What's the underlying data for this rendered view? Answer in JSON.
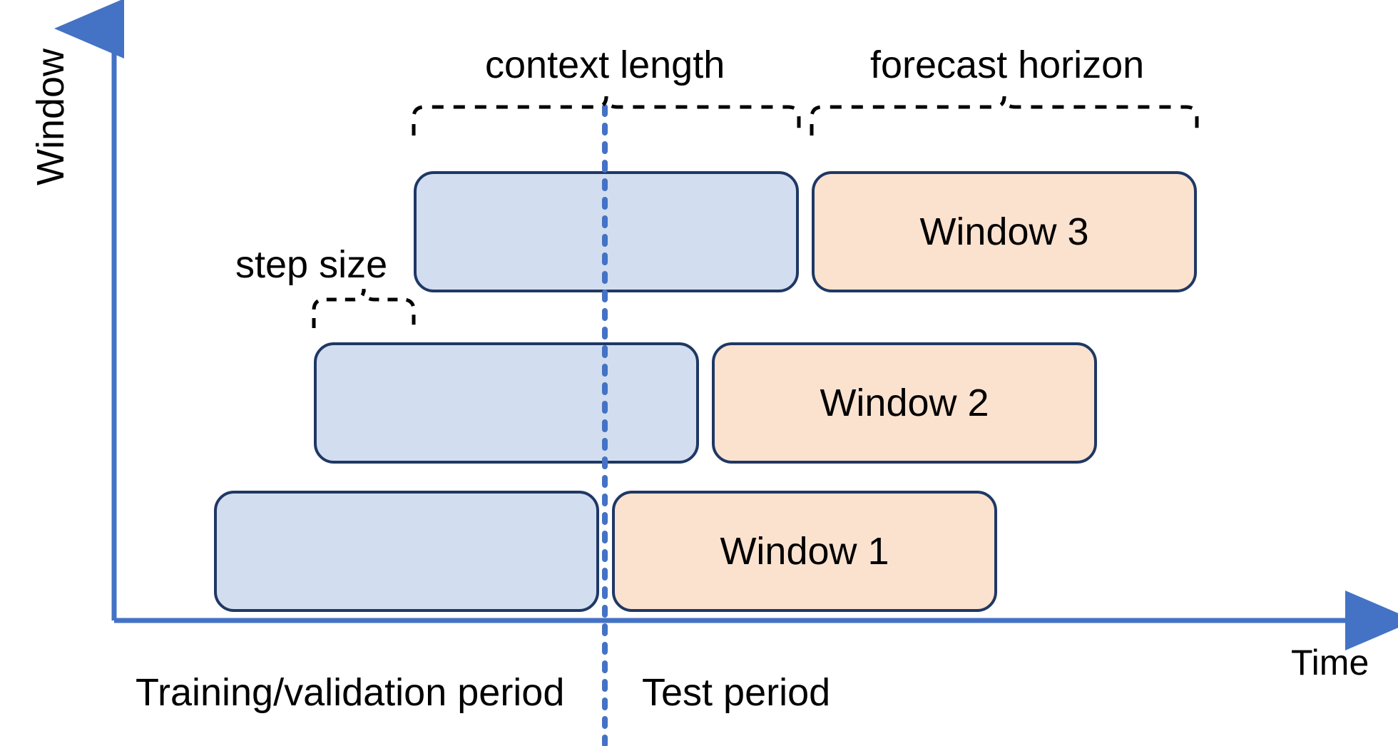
{
  "chart_data": {
    "type": "diagram",
    "title": "",
    "x_axis_label": "Time",
    "y_axis_label": "Window",
    "divider_label_left": "Training/validation period",
    "divider_label_right": "Test period",
    "brace_labels": {
      "step_size": "step size",
      "context_length": "context length",
      "forecast_horizon": "forecast horizon"
    },
    "windows": [
      {
        "name": "Window 1",
        "context_start": 0,
        "context_end": 1,
        "forecast_start": 1,
        "forecast_end": 2
      },
      {
        "name": "Window 2",
        "context_start": 0.25,
        "context_end": 1.25,
        "forecast_start": 1.25,
        "forecast_end": 2.25
      },
      {
        "name": "Window 3",
        "context_start": 0.5,
        "context_end": 1.5,
        "forecast_start": 1.5,
        "forecast_end": 2.5
      }
    ],
    "colors": {
      "axis": "#4472c4",
      "box_border": "#1f3864",
      "context_fill": "#d2deef",
      "forecast_fill": "#fbe2cf",
      "divider": "#4472c4"
    }
  }
}
